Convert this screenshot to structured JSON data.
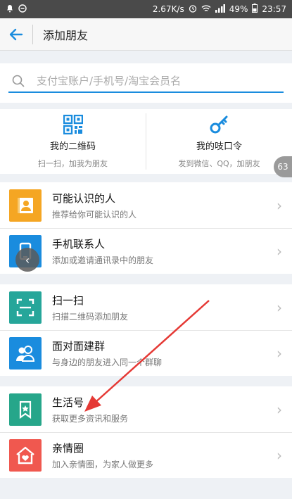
{
  "status": {
    "speed": "2.67K/s",
    "battery": "49%",
    "time": "23:57"
  },
  "header": {
    "title": "添加朋友"
  },
  "search": {
    "placeholder": "支付宝账户/手机号/淘宝会员名"
  },
  "quick": [
    {
      "title": "我的二维码",
      "sub": "扫一扫，加我为朋友"
    },
    {
      "title": "我的吱口令",
      "sub": "发到微信、QQ，加朋友"
    }
  ],
  "badge": "63",
  "groups": [
    [
      {
        "title": "可能认识的人",
        "sub": "推荐给你可能认识的人",
        "color": "#f5a623",
        "icon": "contact-book-icon"
      },
      {
        "title": "手机联系人",
        "sub": "添加或邀请通讯录中的朋友",
        "color": "#1a8cde",
        "icon": "phone-icon"
      }
    ],
    [
      {
        "title": "扫一扫",
        "sub": "扫描二维码添加朋友",
        "color": "#26a69a",
        "icon": "scan-icon"
      },
      {
        "title": "面对面建群",
        "sub": "与身边的朋友进入同一个群聊",
        "color": "#1a8cde",
        "icon": "group-icon"
      }
    ],
    [
      {
        "title": "生活号",
        "sub": "获取更多资讯和服务",
        "color": "#26a68a",
        "icon": "lifestyle-bookmark-icon"
      },
      {
        "title": "亲情圈",
        "sub": "加入亲情圈，为家人做更多",
        "color": "#f0584f",
        "icon": "home-heart-icon"
      }
    ]
  ]
}
